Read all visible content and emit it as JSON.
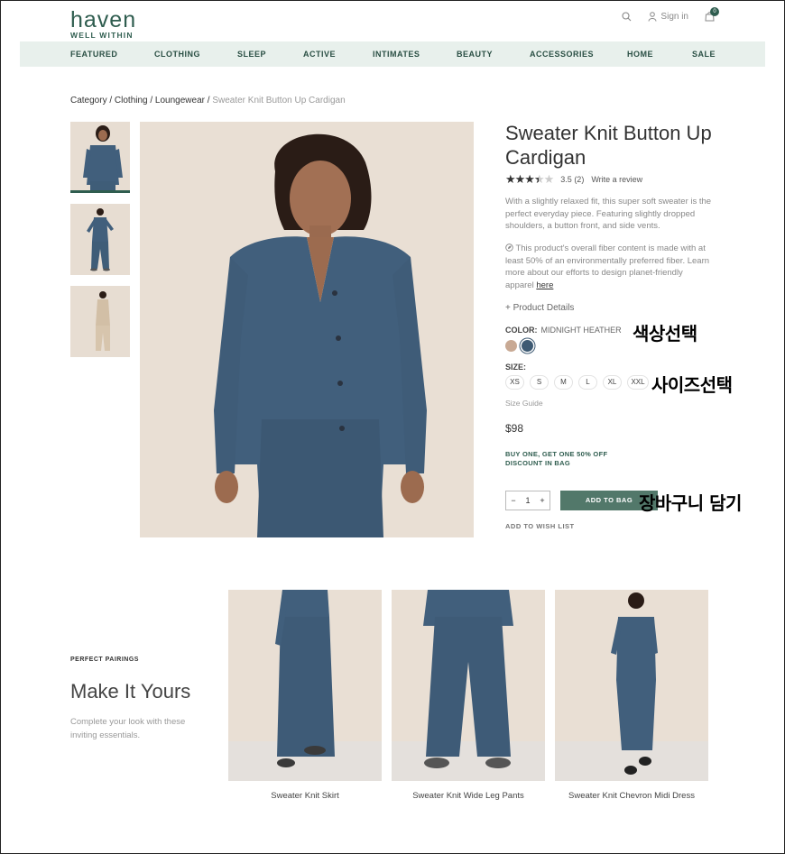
{
  "header": {
    "logo_main": "haven",
    "logo_sub": "WELL WITHIN",
    "sign_in": "Sign in",
    "bag_count": "0"
  },
  "nav": [
    "FEATURED",
    "CLOTHING",
    "SLEEP",
    "ACTIVE",
    "INTIMATES",
    "BEAUTY",
    "ACCESSORIES",
    "HOME",
    "SALE"
  ],
  "breadcrumb": {
    "path": "Category / Clothing / Loungewear / ",
    "current": "Sweater Knit Button Up Cardigan"
  },
  "product": {
    "title": "Sweater Knit Button Up Cardigan",
    "rating_value": "3.5",
    "rating_count": "(2)",
    "write_review": "Write a review",
    "description": "With a slightly relaxed fit, this super soft sweater is the perfect everyday piece. Featuring slightly dropped shoulders, a button front, and side vents.",
    "fiber_text": "This product's overall fiber content is made with at least 50% of an environmentally preferred fiber. Learn more about our efforts to design planet-friendly apparel",
    "fiber_link": "here",
    "details_label": "Product Details",
    "color_label": "COLOR:",
    "color_value": "MIDNIGHT HEATHER",
    "swatch_colors": [
      "#c8a994",
      "#3e5a73"
    ],
    "size_label": "SIZE:",
    "sizes": [
      "XS",
      "S",
      "M",
      "L",
      "XL",
      "XXL"
    ],
    "size_guide": "Size Guide",
    "price": "$98",
    "promo": "BUY ONE, GET ONE 50% OFF DISCOUNT IN BAG",
    "quantity": "1",
    "add_to_bag": "ADD TO BAG",
    "wish_list": "ADD TO WISH LIST"
  },
  "annotations": {
    "color_select": "색상선택",
    "size_select": "사이즈선택",
    "add_to_cart": "장바구니 담기"
  },
  "pairings": {
    "eyebrow": "PERFECT PAIRINGS",
    "title": "Make It Yours",
    "subtitle": "Complete your look with these inviting essentials.",
    "items": [
      {
        "name": "Sweater Knit Skirt"
      },
      {
        "name": "Sweater Knit Wide Leg Pants"
      },
      {
        "name": "Sweater Knit Chevron Midi Dress"
      }
    ]
  }
}
